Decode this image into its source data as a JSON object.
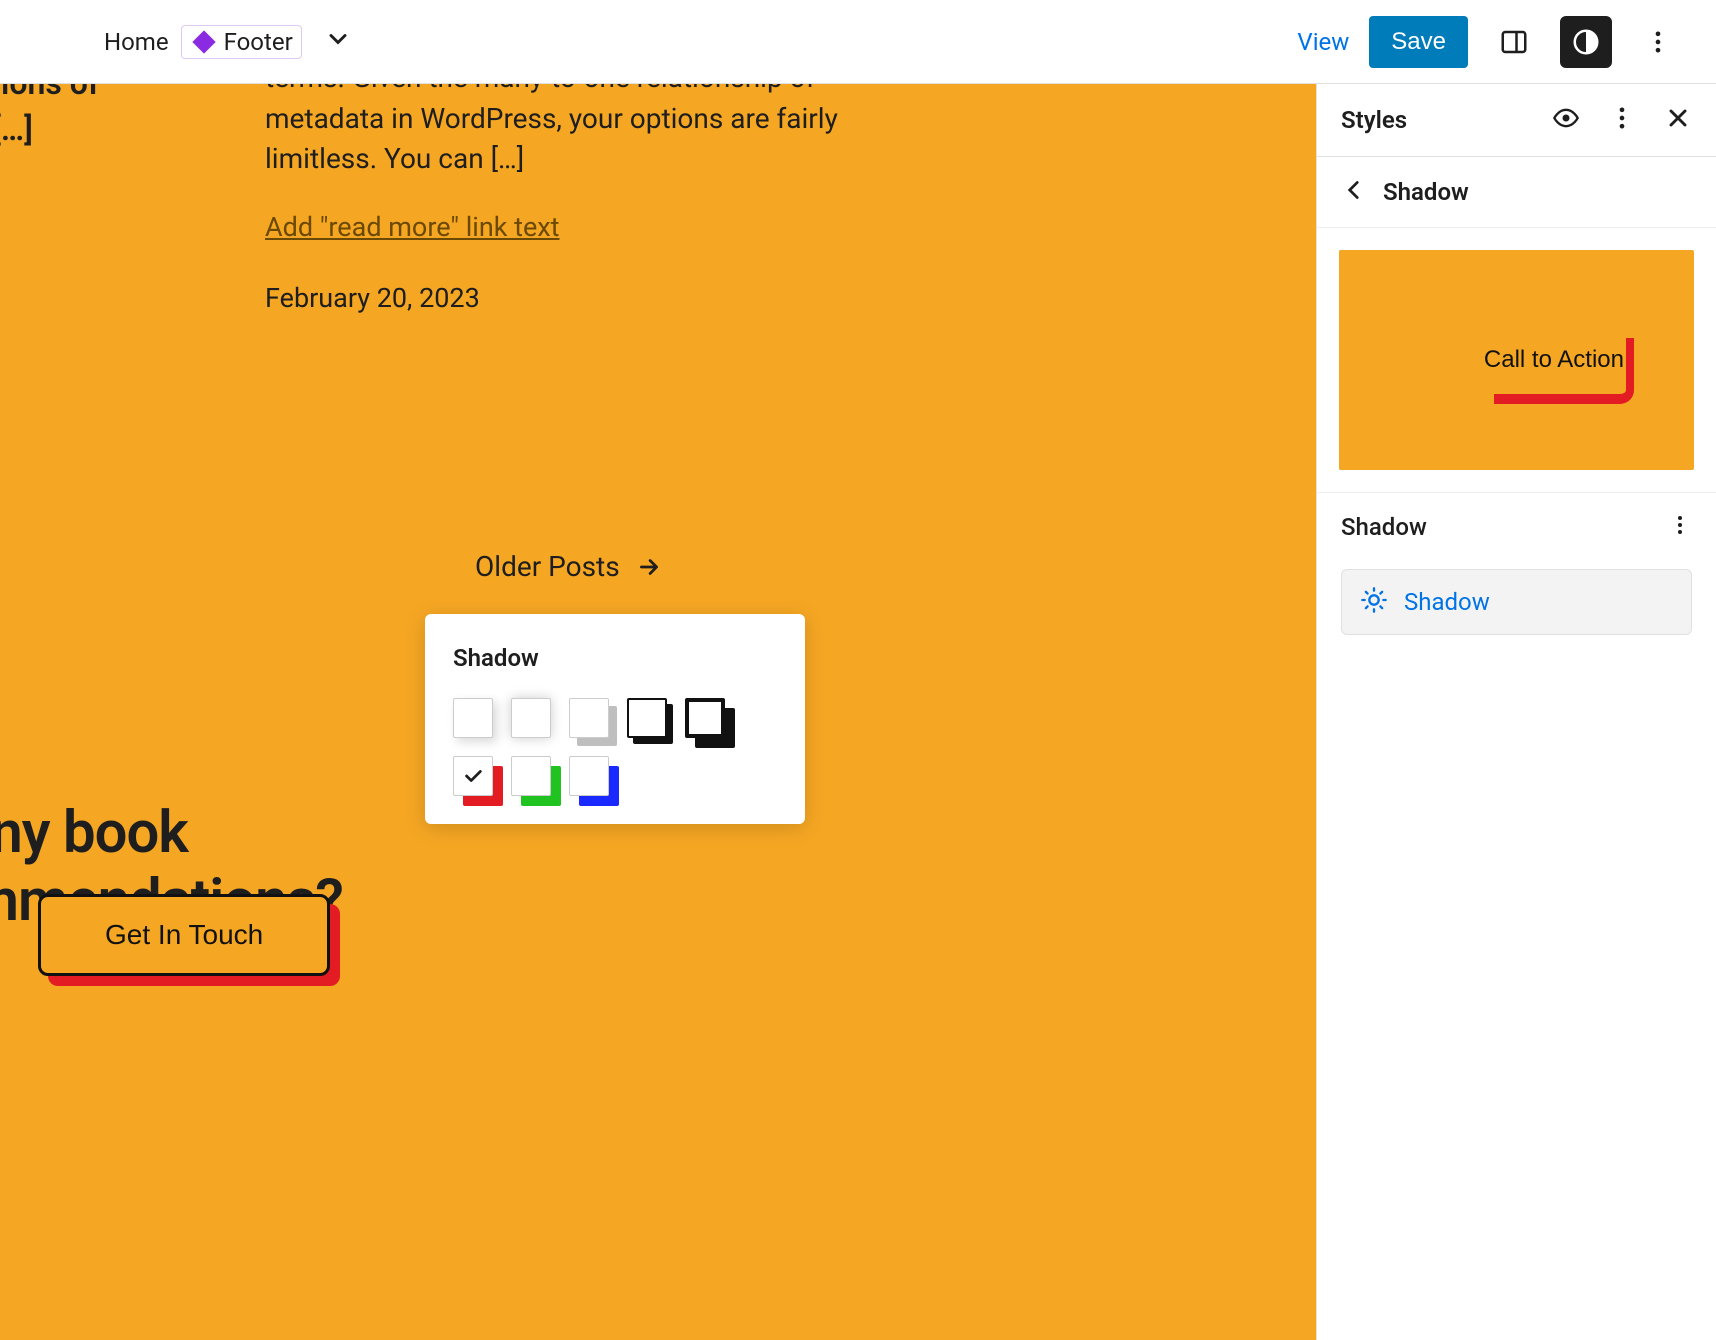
{
  "topbar": {
    "home": "Home",
    "footer": "Footer",
    "view": "View",
    "save": "Save"
  },
  "canvas": {
    "truncated_left_1": "versions of",
    "truncated_left_2": "uld […]",
    "paragraph": "terms. Given the many-to-one relationship of metadata in WordPress, your options are fairly limitless. You can […]",
    "read_more": "Add \"read more\" link text",
    "date": "February 20, 2023",
    "older_posts": "Older Posts",
    "heading": "Got any book recommendations?",
    "button": "Get In Touch"
  },
  "popover": {
    "title": "Shadow",
    "selected_index": 5
  },
  "sidebar": {
    "title": "Styles",
    "nav": "Shadow",
    "preview_button": "Call to Action",
    "section_label": "Shadow",
    "shadow_button": "Shadow"
  },
  "colors": {
    "accent": "#f5a623",
    "shadow_red": "#e31b23",
    "link": "#0073e6"
  }
}
